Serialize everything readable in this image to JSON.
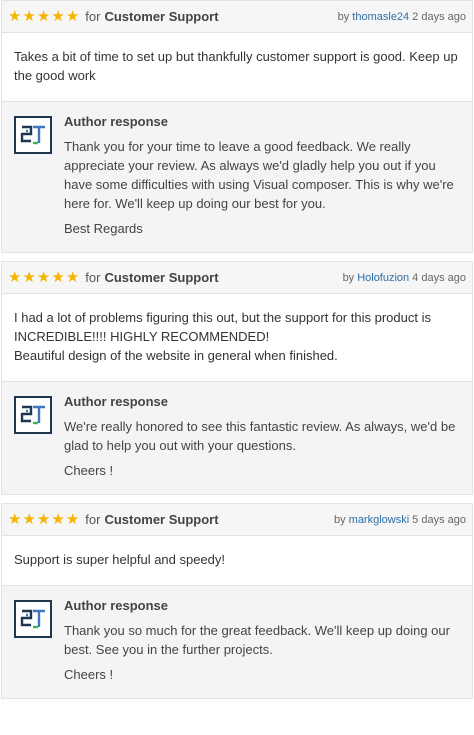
{
  "reviews": [
    {
      "stars": 5,
      "for_label": "for",
      "category": "Customer Support",
      "by_label": "by",
      "author": "thomasle24",
      "date": "2 days ago",
      "body": [
        "Takes a bit of time to set up but thankfully customer support is good. Keep up the good work"
      ],
      "response": {
        "title": "Author response",
        "text": "Thank you for your time to leave a good feedback. We really appreciate your review. As always we'd gladly help you out if you have some difficulties with using Visual composer. This is why we're here for. We'll keep up doing our best for you.",
        "sign": "Best Regards"
      }
    },
    {
      "stars": 5,
      "for_label": "for",
      "category": "Customer Support",
      "by_label": "by",
      "author": "Holofuzion",
      "date": "4 days ago",
      "body": [
        "I had a lot of problems figuring this out, but the support for this product is INCREDIBLE!!!! HIGHLY RECOMMENDED!",
        "Beautiful design of the website in general when finished."
      ],
      "response": {
        "title": "Author response",
        "text": "We're really honored to see this fantastic review. As always, we'd be glad to help you out with your questions.",
        "sign": "Cheers !"
      }
    },
    {
      "stars": 5,
      "for_label": "for",
      "category": "Customer Support",
      "by_label": "by",
      "author": "markglowski",
      "date": "5 days ago",
      "body": [
        "Support is super helpful and speedy!"
      ],
      "response": {
        "title": "Author response",
        "text": "Thank you so much for the great feedback. We'll keep up doing our best. See you in the further projects.",
        "sign": "Cheers !"
      }
    }
  ],
  "icons": {
    "star": "star-icon",
    "logo": "author-logo-icon"
  },
  "colors": {
    "star": "#f4b400",
    "author_link": "#2d6da3",
    "logo_dark": "#1f3550",
    "logo_blue": "#3a78c2",
    "logo_green": "#3bb54a"
  }
}
